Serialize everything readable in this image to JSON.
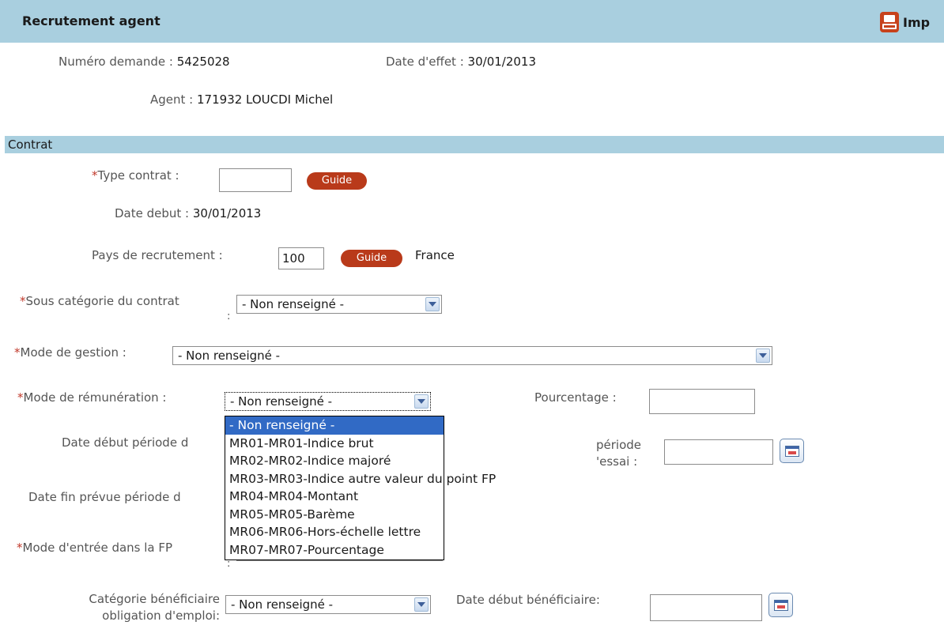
{
  "header": {
    "title": "Recrutement agent",
    "print_label": "Imp"
  },
  "summary": {
    "numero_label": "Numéro demande :",
    "numero_value": "5425028",
    "date_effet_label": "Date d'effet :",
    "date_effet_value": "30/01/2013",
    "agent_label": "Agent :",
    "agent_value": "171932 LOUCDI Michel"
  },
  "section": {
    "title": "Contrat"
  },
  "form": {
    "required_mark": "*",
    "type_contrat_label": "Type contrat :",
    "type_contrat_value": "",
    "guide_label": "Guide",
    "date_debut_label": "Date debut :",
    "date_debut_value": "30/01/2013",
    "pays_label": "Pays de recrutement :",
    "pays_value": "100",
    "pays_name": "France",
    "sous_categorie_label": "Sous catégorie du contrat",
    "colon": ":",
    "sous_categorie_value": "- Non renseigné -",
    "mode_gestion_label": "Mode de gestion :",
    "mode_gestion_value": "- Non renseigné -",
    "mode_remuneration_label": "Mode de rémunération :",
    "mode_remuneration_value": "- Non renseigné -",
    "pourcentage_label": "Pourcentage :",
    "pourcentage_value": "",
    "date_debut_periode_label": "Date début période",
    "date_debut_periode_trail": "d",
    "periode_label_part1": "période",
    "periode_label_part2": "'essai :",
    "date_fin_prevue_label": "Date fin prévue période",
    "date_fin_prevue_trail": "d",
    "mode_entree_label": "Mode d'entrée dans la FP",
    "categorie_benef_label_1": "Catégorie bénéficiaire",
    "categorie_benef_label_2": "obligation d'emploi:",
    "categorie_benef_value": "- Non renseigné -",
    "date_debut_benef_label": "Date début bénéficiaire:",
    "date_debut_benef_value": ""
  },
  "dropdown": {
    "options": [
      "- Non renseigné -",
      "MR01-MR01-Indice brut",
      "MR02-MR02-Indice majoré",
      "MR03-MR03-Indice autre valeur du point FP",
      "MR04-MR04-Montant",
      "MR05-MR05-Barème",
      "MR06-MR06-Hors-échelle lettre",
      "MR07-MR07-Pourcentage"
    ],
    "selected_index": 0
  },
  "colors": {
    "header_bg": "#a9cfdf",
    "guide_bg": "#b93a1a",
    "selection_bg": "#316ac5",
    "required": "#c0392b"
  },
  "icons": [
    "printer-icon",
    "calendar-icon",
    "chevron-down-icon"
  ]
}
